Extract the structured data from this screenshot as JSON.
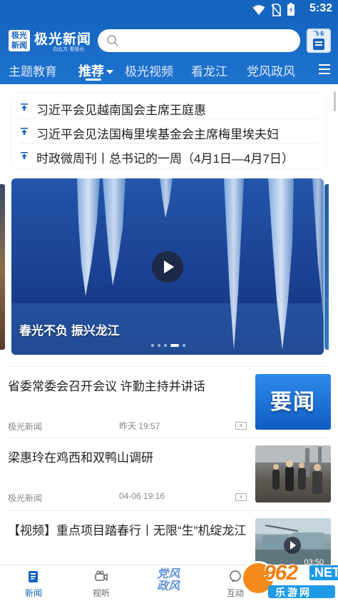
{
  "status_bar": {
    "time": "5:32"
  },
  "header": {
    "logo_text": "极光新闻",
    "logo_box_line1": "极光",
    "logo_box_line2": "新闻",
    "slogan": "向北方·看极光",
    "feika_label": "飞卡",
    "tabs": [
      {
        "label": "主题教育"
      },
      {
        "label": "推荐"
      },
      {
        "label": "极光视频"
      },
      {
        "label": "看龙江"
      },
      {
        "label": "党风政风"
      }
    ],
    "active_tab": "推荐"
  },
  "headlines": [
    {
      "text": "习近平会见越南国会主席王庭惠"
    },
    {
      "text": "习近平会见法国梅里埃基金会主席梅里埃夫妇"
    },
    {
      "text": "时政微周刊丨总书记的一周（4月1日—4月7日）"
    }
  ],
  "carousel": {
    "caption": "春光不负 振兴龙江",
    "slide_count": 5,
    "active_slide": 4
  },
  "news": [
    {
      "title": "省委常委会召开会议 许勤主持并讲话",
      "source": "极光新闻",
      "time": "昨天 19:57",
      "thumb_text": "要闻"
    },
    {
      "title": "梁惠玲在鸡西和双鸭山调研",
      "source": "极光新闻",
      "time": "04-06 19:16"
    },
    {
      "title": "【视频】重点项目踏春行丨无限“生”机绽龙江",
      "source": "",
      "time": "",
      "duration": "03:50"
    }
  ],
  "bottom_nav": [
    {
      "label": "新闻",
      "icon": "news-icon"
    },
    {
      "label": "视听",
      "icon": "video-camera-icon"
    },
    {
      "label": "党风\n政风",
      "icon": ""
    },
    {
      "label": "互动",
      "icon": "chat-icon"
    }
  ],
  "watermark": {
    "num": "962",
    "domain": ".NET",
    "name": "乐游网"
  },
  "colors": {
    "brand": "#1565c0",
    "accent": "#1e73cf"
  }
}
